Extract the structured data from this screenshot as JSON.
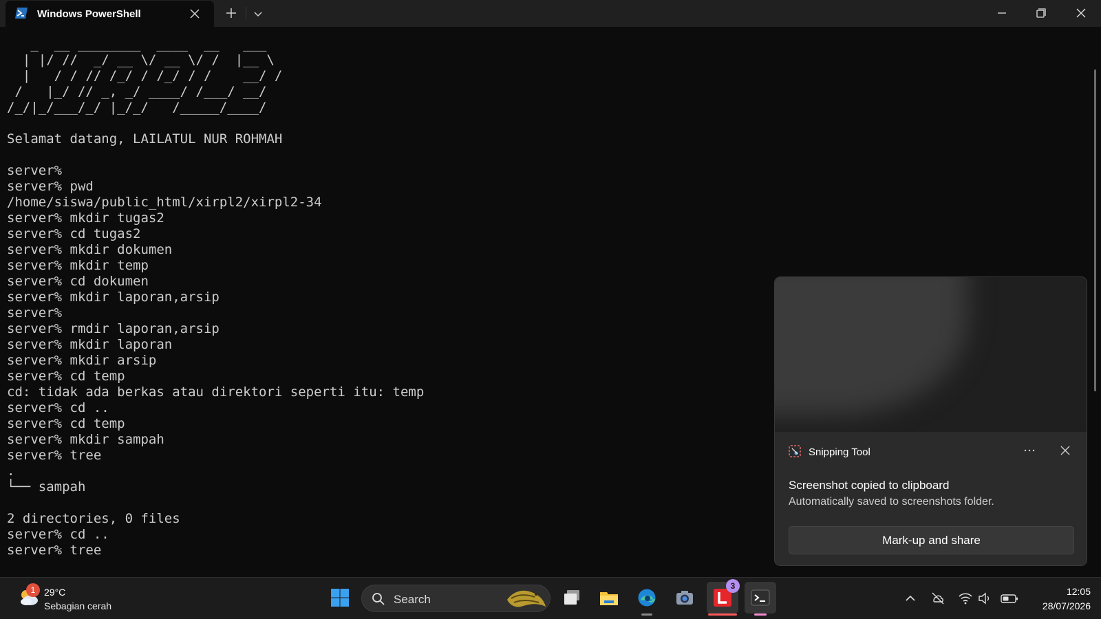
{
  "window": {
    "tab_title": "Windows PowerShell"
  },
  "terminal": {
    "lines": [
      "   _  __ ________  ____  __   ___ ",
      "  | |/ //  _/ __ \\/ __ \\/ /  |__ \\",
      "  |   / / // /_/ / /_/ / /    __/ /",
      " /   |_/ // _, _/ ____/ /___/ __/ ",
      "/_/|_/___/_/ |_/_/   /_____/____/ ",
      "",
      "Selamat datang, LAILATUL NUR ROHMAH",
      "",
      "server%",
      "server% pwd",
      "/home/siswa/public_html/xirpl2/xirpl2-34",
      "server% mkdir tugas2",
      "server% cd tugas2",
      "server% mkdir dokumen",
      "server% mkdir temp",
      "server% cd dokumen",
      "server% mkdir laporan,arsip",
      "server%",
      "server% rmdir laporan,arsip",
      "server% mkdir laporan",
      "server% mkdir arsip",
      "server% cd temp",
      "cd: tidak ada berkas atau direktori seperti itu: temp",
      "server% cd ..",
      "server% cd temp",
      "server% mkdir sampah",
      "server% tree",
      ".",
      "└── sampah",
      "",
      "2 directories, 0 files",
      "server% cd ..",
      "server% tree"
    ]
  },
  "notification": {
    "app_name": "Snipping Tool",
    "title": "Screenshot copied to clipboard",
    "message": "Automatically saved to screenshots folder.",
    "action_label": "Mark-up and share",
    "more_icon": "ellipsis-icon",
    "close_icon": "close-icon"
  },
  "taskbar": {
    "weather": {
      "temperature": "29°C",
      "condition": "Sebagian cerah",
      "badge": "1"
    },
    "search_label": "Search",
    "apps": [
      {
        "name": "start",
        "icon": "windows-start-icon"
      },
      {
        "name": "task-view",
        "icon": "task-view-icon"
      },
      {
        "name": "file-explorer",
        "icon": "folder-icon"
      },
      {
        "name": "edge",
        "icon": "edge-icon"
      },
      {
        "name": "camera",
        "icon": "camera-icon"
      },
      {
        "name": "l-app",
        "icon": "l-app-icon",
        "badge": "3"
      },
      {
        "name": "terminal",
        "icon": "terminal-icon"
      }
    ],
    "clock": {
      "time": "12:05",
      "date": "28/07/2026"
    }
  },
  "colors": {
    "terminal_bg": "#0c0c0c",
    "terminal_fg": "#cccccc",
    "titlebar_bg": "#202020",
    "taskbar_bg": "#1c1c1c",
    "accent_pink": "#f28bd0",
    "badge_red": "#e0503c",
    "badge_purple": "#b48ff0"
  }
}
